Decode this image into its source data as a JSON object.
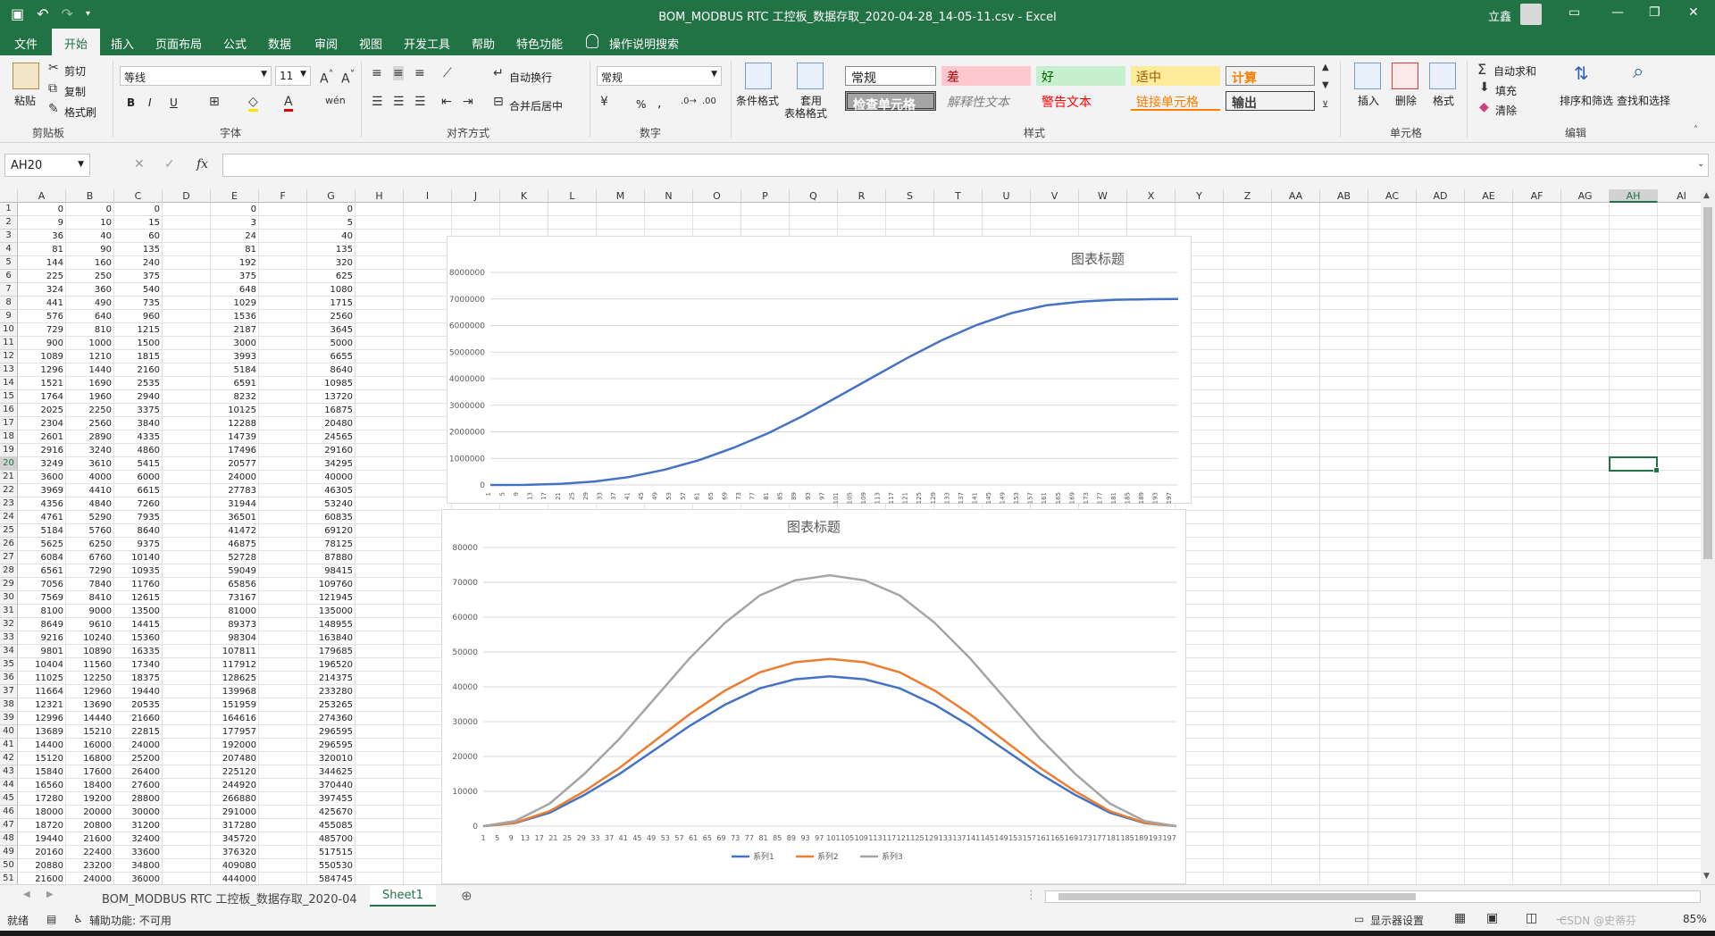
{
  "window": {
    "title": "BOM_MODBUS RTC 工控板_数据存取_2020-04-28_14-05-11.csv  -  Excel",
    "user": "立鑫"
  },
  "menu": {
    "tabs": [
      "文件",
      "开始",
      "插入",
      "页面布局",
      "公式",
      "数据",
      "审阅",
      "视图",
      "开发工具",
      "帮助",
      "特色功能"
    ],
    "active": "开始",
    "tell_me": "操作说明搜索"
  },
  "ribbon": {
    "clipboard": {
      "paste": "粘贴",
      "cut": "剪切",
      "copy": "复制",
      "format_painter": "格式刷",
      "label": "剪贴板"
    },
    "font": {
      "name": "等线",
      "size": "11",
      "bold": "B",
      "italic": "I",
      "underline": "U",
      "label": "字体"
    },
    "alignment": {
      "wrap": "自动换行",
      "merge": "合并后居中",
      "label": "对齐方式"
    },
    "number": {
      "format": "常规",
      "percent": "%",
      "comma": ",",
      "label": "数字"
    },
    "styles": {
      "conditional": "条件格式",
      "table": "套用\n表格格式",
      "table_line1": "套用",
      "table_line2": "表格格式",
      "cells": [
        "常规",
        "差",
        "好",
        "适中",
        "计算",
        "检查单元格",
        "解释性文本",
        "警告文本",
        "链接单元格",
        "输出"
      ],
      "label": "样式"
    },
    "cells": {
      "insert": "插入",
      "delete": "删除",
      "format": "格式",
      "label": "单元格"
    },
    "editing": {
      "autosum": "自动求和",
      "fill": "填充",
      "clear": "清除",
      "sort": "排序和筛选",
      "find": "查找和选择",
      "label": "编辑"
    }
  },
  "formula_bar": {
    "name_box": "AH20",
    "fx": "fx",
    "value": ""
  },
  "columns": [
    "A",
    "B",
    "C",
    "D",
    "E",
    "F",
    "G",
    "H",
    "I",
    "J",
    "K",
    "L",
    "M",
    "N",
    "O",
    "P",
    "Q",
    "R",
    "S",
    "T",
    "U",
    "V",
    "W",
    "X",
    "Y",
    "Z",
    "AA",
    "AB",
    "AC",
    "AD",
    "AE",
    "AF",
    "AG",
    "AH",
    "AI"
  ],
  "rows": [
    [
      0,
      0,
      0,
      null,
      0,
      null,
      0
    ],
    [
      9,
      10,
      15,
      null,
      3,
      null,
      5
    ],
    [
      36,
      40,
      60,
      null,
      24,
      null,
      40
    ],
    [
      81,
      90,
      135,
      null,
      81,
      null,
      135
    ],
    [
      144,
      160,
      240,
      null,
      192,
      null,
      320
    ],
    [
      225,
      250,
      375,
      null,
      375,
      null,
      625
    ],
    [
      324,
      360,
      540,
      null,
      648,
      null,
      1080
    ],
    [
      441,
      490,
      735,
      null,
      1029,
      null,
      1715
    ],
    [
      576,
      640,
      960,
      null,
      1536,
      null,
      2560
    ],
    [
      729,
      810,
      1215,
      null,
      2187,
      null,
      3645
    ],
    [
      900,
      1000,
      1500,
      null,
      3000,
      null,
      5000
    ],
    [
      1089,
      1210,
      1815,
      null,
      3993,
      null,
      6655
    ],
    [
      1296,
      1440,
      2160,
      null,
      5184,
      null,
      8640
    ],
    [
      1521,
      1690,
      2535,
      null,
      6591,
      null,
      10985
    ],
    [
      1764,
      1960,
      2940,
      null,
      8232,
      null,
      13720
    ],
    [
      2025,
      2250,
      3375,
      null,
      10125,
      null,
      16875
    ],
    [
      2304,
      2560,
      3840,
      null,
      12288,
      null,
      20480
    ],
    [
      2601,
      2890,
      4335,
      null,
      14739,
      null,
      24565
    ],
    [
      2916,
      3240,
      4860,
      null,
      17496,
      null,
      29160
    ],
    [
      3249,
      3610,
      5415,
      null,
      20577,
      null,
      34295
    ],
    [
      3600,
      4000,
      6000,
      null,
      24000,
      null,
      40000
    ],
    [
      3969,
      4410,
      6615,
      null,
      27783,
      null,
      46305
    ],
    [
      4356,
      4840,
      7260,
      null,
      31944,
      null,
      53240
    ],
    [
      4761,
      5290,
      7935,
      null,
      36501,
      null,
      60835
    ],
    [
      5184,
      5760,
      8640,
      null,
      41472,
      null,
      69120
    ],
    [
      5625,
      6250,
      9375,
      null,
      46875,
      null,
      78125
    ],
    [
      6084,
      6760,
      10140,
      null,
      52728,
      null,
      87880
    ],
    [
      6561,
      7290,
      10935,
      null,
      59049,
      null,
      98415
    ],
    [
      7056,
      7840,
      11760,
      null,
      65856,
      null,
      109760
    ],
    [
      7569,
      8410,
      12615,
      null,
      73167,
      null,
      121945
    ],
    [
      8100,
      9000,
      13500,
      null,
      81000,
      null,
      135000
    ],
    [
      8649,
      9610,
      14415,
      null,
      89373,
      null,
      148955
    ],
    [
      9216,
      10240,
      15360,
      null,
      98304,
      null,
      163840
    ],
    [
      9801,
      10890,
      16335,
      null,
      107811,
      null,
      179685
    ],
    [
      10404,
      11560,
      17340,
      null,
      117912,
      null,
      196520
    ],
    [
      11025,
      12250,
      18375,
      null,
      128625,
      null,
      214375
    ],
    [
      11664,
      12960,
      19440,
      null,
      139968,
      null,
      233280
    ],
    [
      12321,
      13690,
      20535,
      null,
      151959,
      null,
      253265
    ],
    [
      12996,
      14440,
      21660,
      null,
      164616,
      null,
      274360
    ],
    [
      13689,
      15210,
      22815,
      null,
      177957,
      null,
      296595
    ],
    [
      14400,
      16000,
      24000,
      null,
      192000,
      null,
      296595
    ],
    [
      15120,
      16800,
      25200,
      null,
      207480,
      null,
      320010
    ],
    [
      15840,
      17600,
      26400,
      null,
      225120,
      null,
      344625
    ],
    [
      16560,
      18400,
      27600,
      null,
      244920,
      null,
      370440
    ],
    [
      17280,
      19200,
      28800,
      null,
      266880,
      null,
      397455
    ],
    [
      18000,
      20000,
      30000,
      null,
      291000,
      null,
      425670
    ],
    [
      18720,
      20800,
      31200,
      null,
      317280,
      null,
      455085
    ],
    [
      19440,
      21600,
      32400,
      null,
      345720,
      null,
      485700
    ],
    [
      20160,
      22400,
      33600,
      null,
      376320,
      null,
      517515
    ],
    [
      20880,
      23200,
      34800,
      null,
      409080,
      null,
      550530
    ],
    [
      21600,
      24000,
      36000,
      null,
      444000,
      null,
      584745
    ]
  ],
  "selected_cell": "AH20",
  "chart_data": [
    {
      "type": "line",
      "title": "图表标题",
      "x_tick_labels": [
        "1",
        "5",
        "9",
        "13",
        "17",
        "21",
        "25",
        "29",
        "33",
        "37",
        "41",
        "45",
        "49",
        "53",
        "57",
        "61",
        "65",
        "69",
        "73",
        "77",
        "81",
        "85",
        "89",
        "93",
        "97",
        "101",
        "105",
        "109",
        "113",
        "117",
        "121",
        "125",
        "129",
        "133",
        "137",
        "141",
        "145",
        "149",
        "153",
        "157",
        "161",
        "165",
        "169",
        "173",
        "177",
        "181",
        "185",
        "189",
        "193",
        "197"
      ],
      "ylim": [
        0,
        8000000
      ],
      "y_ticks": [
        0,
        1000000,
        2000000,
        3000000,
        4000000,
        5000000,
        6000000,
        7000000,
        8000000
      ],
      "series": [
        {
          "color": "#4472c4",
          "x": [
            1,
            11,
            21,
            31,
            41,
            51,
            61,
            71,
            81,
            91,
            101,
            111,
            121,
            131,
            141,
            151,
            161,
            171,
            181,
            191,
            199
          ],
          "values": [
            0,
            5000,
            40000,
            130000,
            300000,
            570000,
            930000,
            1400000,
            1950000,
            2600000,
            3320000,
            4050000,
            4780000,
            5450000,
            6020000,
            6470000,
            6760000,
            6900000,
            6970000,
            6990000,
            7000000
          ]
        }
      ],
      "grid": true
    },
    {
      "type": "line",
      "title": "图表标题",
      "x_tick_labels": [
        "1",
        "5",
        "9",
        "13",
        "17",
        "21",
        "25",
        "29",
        "33",
        "37",
        "41",
        "45",
        "49",
        "53",
        "57",
        "61",
        "65",
        "69",
        "73",
        "77",
        "81",
        "85",
        "89",
        "93",
        "97",
        "101",
        "105",
        "109",
        "113",
        "117",
        "121",
        "125",
        "129",
        "133",
        "137",
        "141",
        "145",
        "149",
        "153",
        "157",
        "161",
        "165",
        "169",
        "173",
        "177",
        "181",
        "185",
        "189",
        "193",
        "197"
      ],
      "ylim": [
        0,
        80000
      ],
      "y_ticks": [
        0,
        10000,
        20000,
        30000,
        40000,
        50000,
        60000,
        70000,
        80000
      ],
      "series": [
        {
          "name": "系列1",
          "color": "#4472c4",
          "peak": 43000
        },
        {
          "name": "系列2",
          "color": "#ed7d31",
          "peak": 48000
        },
        {
          "name": "系列3",
          "color": "#a5a5a5",
          "peak": 72000
        }
      ],
      "x": [
        1,
        10,
        20,
        30,
        40,
        50,
        60,
        70,
        80,
        90,
        100,
        110,
        120,
        130,
        140,
        150,
        160,
        170,
        180,
        190,
        199
      ],
      "shape": [
        0,
        0.02,
        0.09,
        0.21,
        0.35,
        0.51,
        0.67,
        0.81,
        0.92,
        0.98,
        1.0,
        0.98,
        0.92,
        0.81,
        0.67,
        0.51,
        0.35,
        0.21,
        0.09,
        0.02,
        0
      ],
      "legend": "bottom",
      "grid": true
    }
  ],
  "sheets": {
    "other": "BOM_MODBUS RTC 工控板_数据存取_2020-04",
    "active": "Sheet1"
  },
  "status": {
    "ready": "就绪",
    "accessibility": "辅助功能: 不可用",
    "display_settings": "显示器设置",
    "zoom": "85%",
    "watermark": "CSDN @史蒂芬"
  }
}
